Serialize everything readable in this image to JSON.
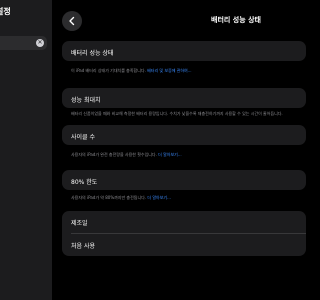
{
  "sidebar": {
    "title": "설정",
    "line1": "",
    "line2": ""
  },
  "header": {
    "title": "배터리 성능 상태"
  },
  "sections": {
    "health": {
      "label": "배터리 성능 상태",
      "note": "이 iPad 배터리 상태가 기대치를 충족합니다.",
      "link": "배터리 및 보증에 관하여..."
    },
    "max_capacity": {
      "label": "성능 최대치",
      "note": "배터리 신품이었을 때와 비교해 측정한 배터리 용량입니다. 수치가 낮을수록 재충전하기까지 사용할 수 있는 시간이 줄어듭니다."
    },
    "cycle_count": {
      "label": "사이클 수",
      "note": "사용자의 iPad가 완전 충전량을 사용한 횟수입니다.",
      "link": "더 알아보기..."
    },
    "limit_80": {
      "label": "80% 한도",
      "note": "사용자의 iPad가 약 80%까지만 충전됩니다.",
      "link": "더 알아보기..."
    },
    "manufacture": {
      "label": "제조일"
    },
    "first_use": {
      "label": "처음 사용"
    }
  },
  "colors": {
    "background": "#000000",
    "card": "#1c1c1e",
    "secondary_text": "#8e8e93",
    "link": "#3a8bff"
  }
}
